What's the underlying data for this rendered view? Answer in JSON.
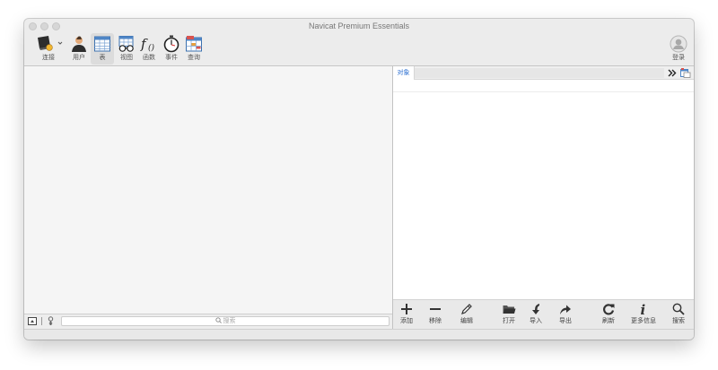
{
  "window": {
    "title": "Navicat Premium Essentials"
  },
  "toolbar": {
    "items": [
      {
        "id": "connect",
        "label": "连接",
        "icon": "connection-icon"
      },
      {
        "id": "user",
        "label": "用户",
        "icon": "user-icon"
      },
      {
        "id": "table",
        "label": "表",
        "icon": "table-icon",
        "active": true
      },
      {
        "id": "view",
        "label": "视图",
        "icon": "view-icon"
      },
      {
        "id": "function",
        "label": "函数",
        "icon": "function-icon"
      },
      {
        "id": "event",
        "label": "事件",
        "icon": "event-icon"
      },
      {
        "id": "query",
        "label": "查询",
        "icon": "query-icon"
      }
    ],
    "login": {
      "label": "登录",
      "icon": "account-icon"
    }
  },
  "left": {
    "search_placeholder": "搜索"
  },
  "right": {
    "tab_label": "对象",
    "more_icon": "double-chevron-icon",
    "object_toolbar": [
      {
        "id": "add",
        "label": "添加",
        "icon": "plus-icon"
      },
      {
        "id": "remove",
        "label": "移除",
        "icon": "minus-icon"
      },
      {
        "id": "edit",
        "label": "编辑",
        "icon": "pencil-icon"
      },
      {
        "id": "open",
        "label": "打开",
        "icon": "folder-icon"
      },
      {
        "id": "import",
        "label": "导入",
        "icon": "import-arrow-icon"
      },
      {
        "id": "export",
        "label": "导出",
        "icon": "export-arrow-icon"
      },
      {
        "id": "refresh",
        "label": "刷新",
        "icon": "refresh-icon"
      },
      {
        "id": "info",
        "label": "更多信息",
        "icon": "info-icon"
      },
      {
        "id": "search",
        "label": "搜索",
        "icon": "search-icon"
      }
    ]
  },
  "colors": {
    "accent": "#2c6fd1",
    "window_bg": "#ececec",
    "pane_bg": "#f5f5f5"
  }
}
